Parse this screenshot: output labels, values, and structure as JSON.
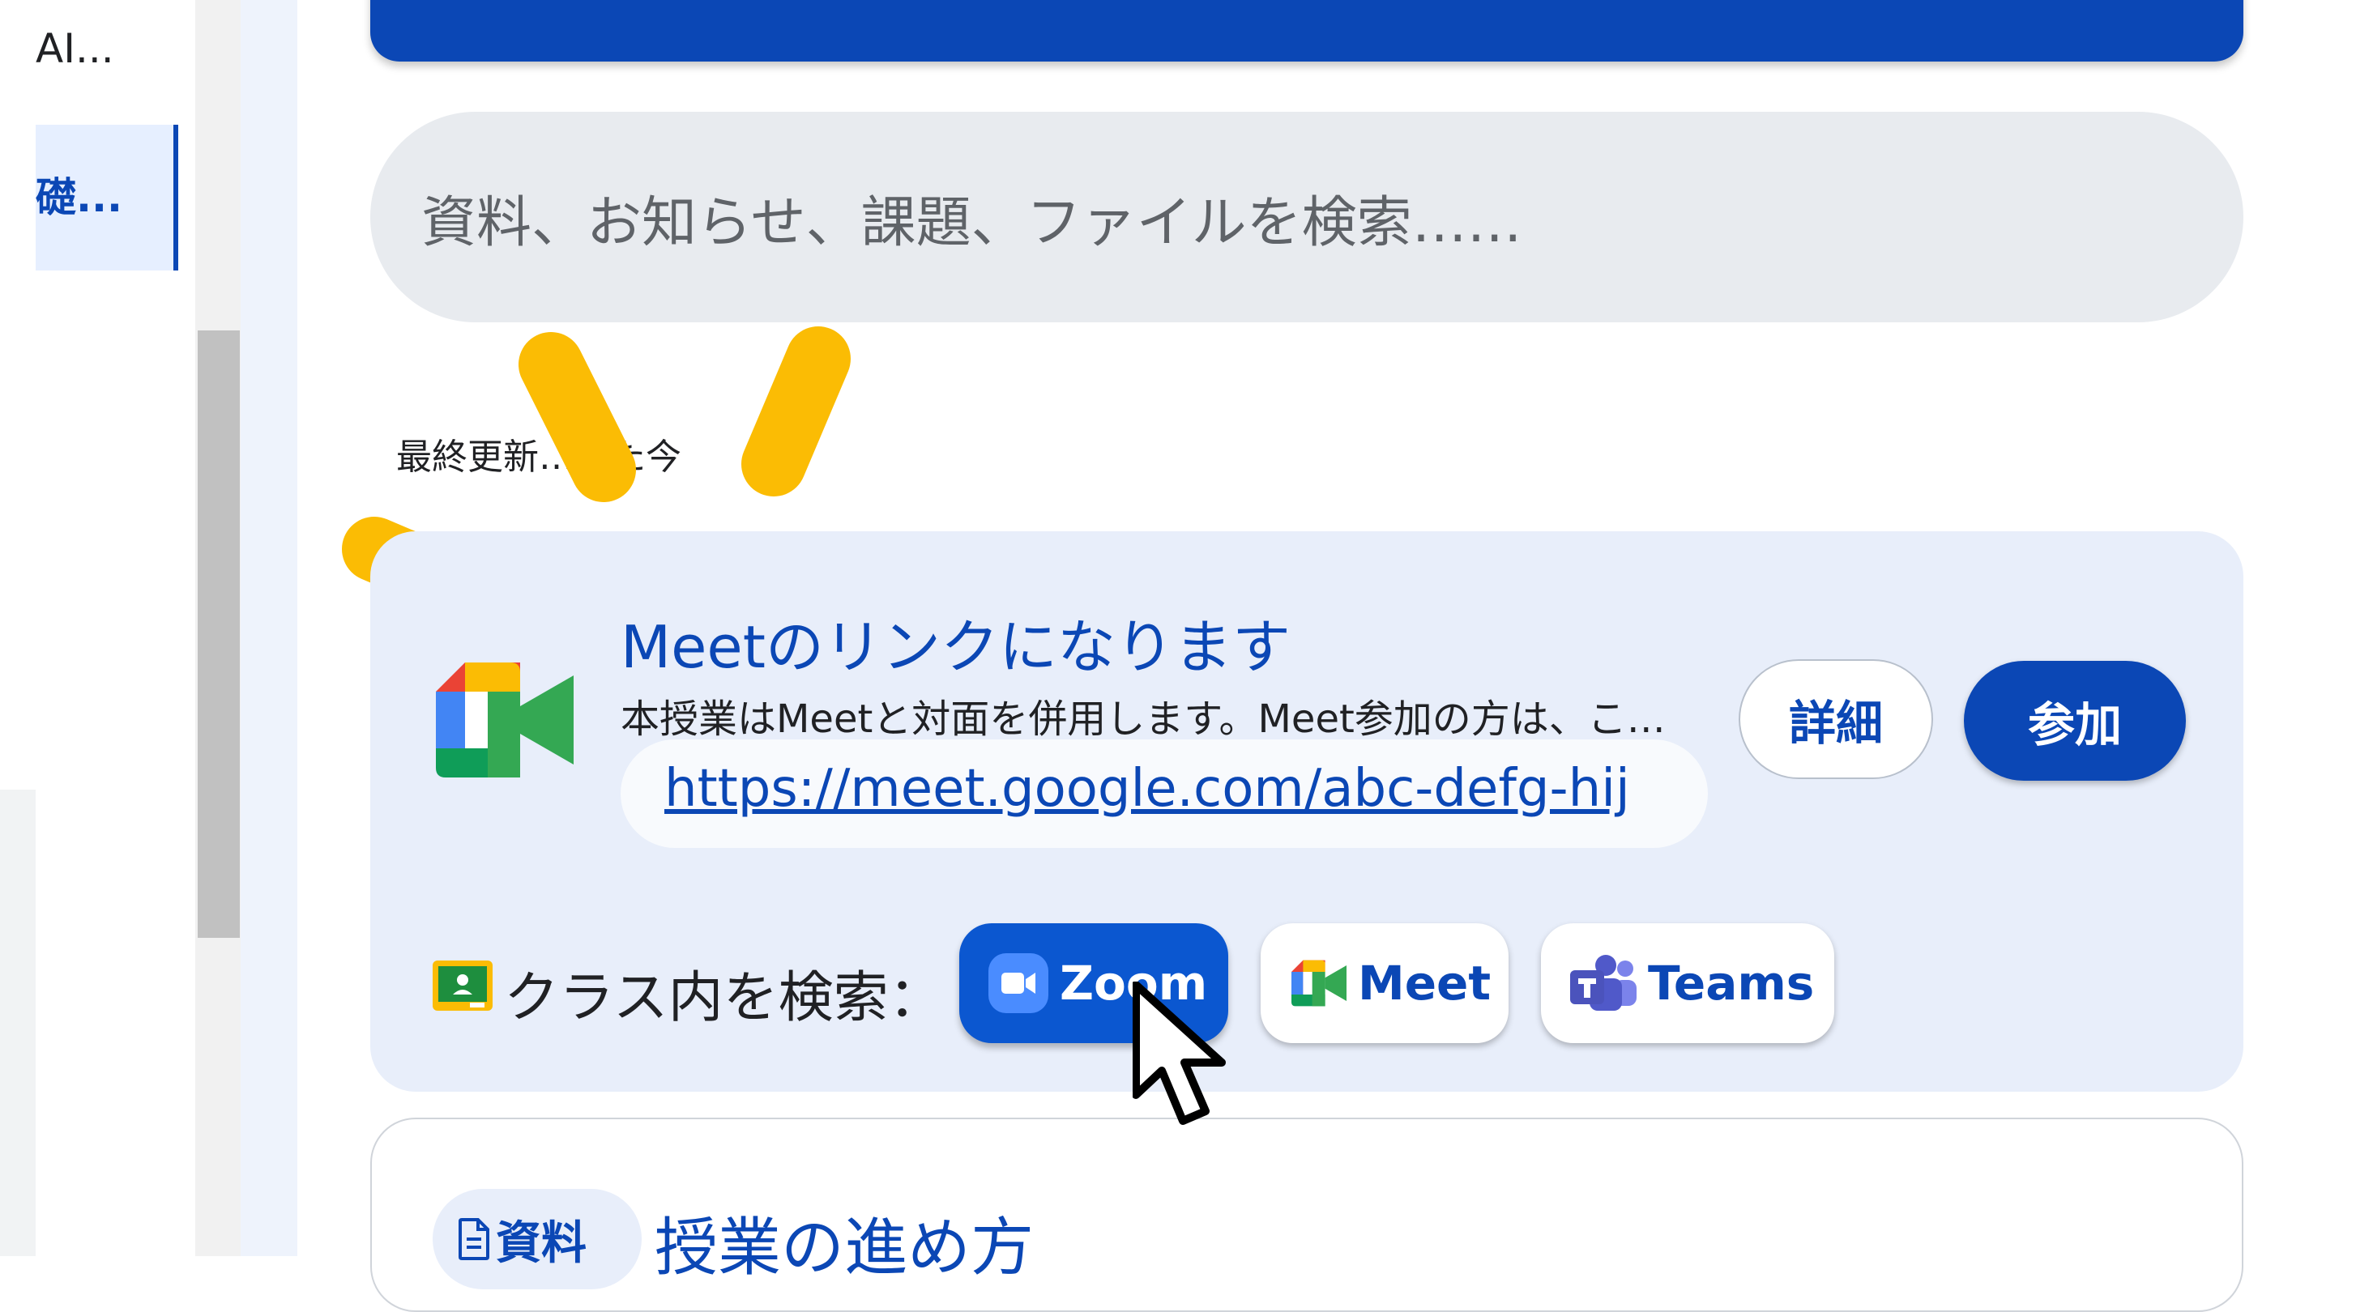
{
  "left_nav": {
    "items": [
      {
        "label": "AI..."
      },
      {
        "label": "礎..."
      }
    ]
  },
  "search": {
    "placeholder": "資料、お知らせ、課題、ファイルを検索……"
  },
  "updated_note": "最終更新…った今",
  "meeting_card": {
    "title": "Meetのリンクになります",
    "description": "本授業はMeetと対面を併用します。Meet参加の方は、こ…",
    "url": "https://meet.google.com/abc-defg-hij",
    "details_button": "詳細",
    "join_button": "参加",
    "search_in_class_label": "クラス内を検索：",
    "platforms": [
      {
        "label": "Zoom",
        "icon": "zoom-icon",
        "selected": true
      },
      {
        "label": "Meet",
        "icon": "google-meet-icon",
        "selected": false
      },
      {
        "label": "Teams",
        "icon": "microsoft-teams-icon",
        "selected": false
      }
    ]
  },
  "material_card": {
    "badge": "資料",
    "title": "授業の進め方"
  },
  "colors": {
    "brand_blue": "#0b47b5",
    "zoom_blue": "#0b57d0",
    "card_background": "#e8eefa",
    "search_background": "#e8ebef",
    "highlight_yellow": "#fbbc04"
  }
}
